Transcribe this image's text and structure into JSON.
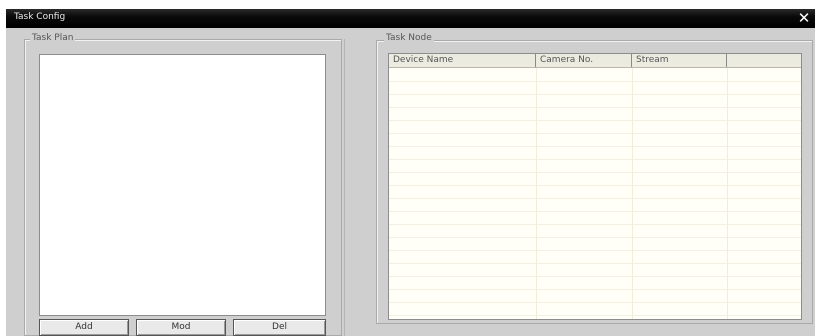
{
  "window": {
    "title": "Task Config",
    "close_glyph": "✕"
  },
  "task_plan": {
    "label": "Task Plan",
    "items": []
  },
  "buttons": {
    "add": "Add",
    "mod": "Mod",
    "del": "Del"
  },
  "task_node": {
    "label": "Task Node",
    "columns": [
      "Device Name",
      "Camera No.",
      "Stream",
      ""
    ],
    "rows": []
  },
  "colors": {
    "titlebar": "#000000",
    "window_bg": "#cfcfcf",
    "list_bg": "#ffffff",
    "table_bg": "#fffff8"
  }
}
